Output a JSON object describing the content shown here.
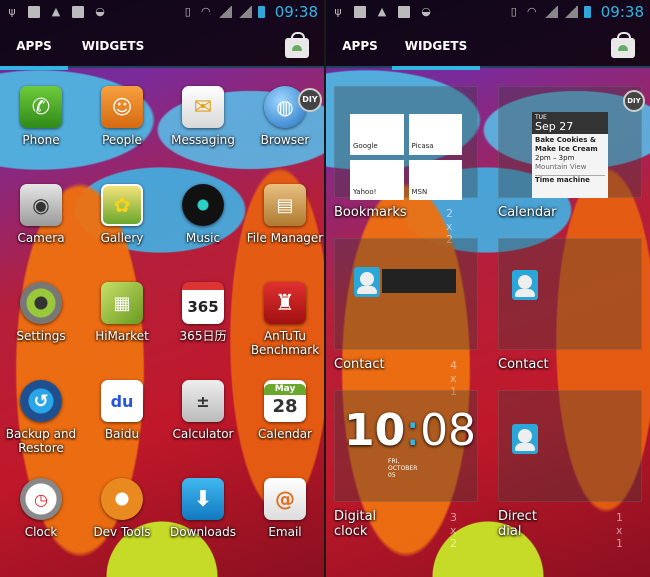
{
  "status_bar": {
    "time": "09:38"
  },
  "tabs": {
    "apps": "APPS",
    "widgets": "WIDGETS"
  },
  "apps": [
    {
      "label": "Phone",
      "icon": "phone-icon"
    },
    {
      "label": "People",
      "icon": "people-icon"
    },
    {
      "label": "Messaging",
      "icon": "messaging-icon"
    },
    {
      "label": "Browser",
      "icon": "browser-icon"
    },
    {
      "label": "Camera",
      "icon": "camera-icon"
    },
    {
      "label": "Gallery",
      "icon": "gallery-icon"
    },
    {
      "label": "Music",
      "icon": "music-icon"
    },
    {
      "label": "File Manager",
      "icon": "file-manager-icon"
    },
    {
      "label": "Settings",
      "icon": "settings-icon"
    },
    {
      "label": "HiMarket",
      "icon": "himarket-icon"
    },
    {
      "label": "365日历",
      "icon": "calendar365-icon"
    },
    {
      "label": "AnTuTu Benchmark",
      "icon": "antutu-icon"
    },
    {
      "label": "Backup and Restore",
      "icon": "backup-icon"
    },
    {
      "label": "Baidu",
      "icon": "baidu-icon"
    },
    {
      "label": "Calculator",
      "icon": "calculator-icon"
    },
    {
      "label": "Calendar",
      "icon": "calendar-icon"
    },
    {
      "label": "Clock",
      "icon": "clock-icon"
    },
    {
      "label": "Dev Tools",
      "icon": "dev-tools-icon"
    },
    {
      "label": "Downloads",
      "icon": "downloads-icon"
    },
    {
      "label": "Email",
      "icon": "email-icon"
    }
  ],
  "app_icon_text": {
    "calendar365": "365",
    "baidu": "du",
    "calendar_month": "May",
    "calendar_day": "28",
    "diy": "DIY"
  },
  "widgets": [
    {
      "label": "Bookmarks",
      "dims": "2 x 2"
    },
    {
      "label": "Calendar",
      "dims": ""
    },
    {
      "label": "Contact",
      "dims": "4 x 1"
    },
    {
      "label": "Contact",
      "dims": ""
    },
    {
      "label": "Digital clock",
      "dims": "3 x 2"
    },
    {
      "label": "Direct dial",
      "dims": "1 x 1"
    }
  ],
  "widget_previews": {
    "bookmarks": [
      "Google",
      "Picasa",
      "Yahoo!",
      "MSN"
    ],
    "calendar": {
      "weekday": "TUE",
      "date": "Sep 27",
      "event1": "Bake Cookies & Make Ice Cream",
      "event1_time": "2pm – 3pm",
      "event1_place": "Mountain View",
      "event2": "Time machine"
    },
    "digital_clock": {
      "hours": "10",
      "minutes": "08",
      "date": "FRI, OCTOBER 05"
    }
  },
  "colors": {
    "accent": "#33b5e5",
    "tab_indicator": "#33b5e5"
  }
}
